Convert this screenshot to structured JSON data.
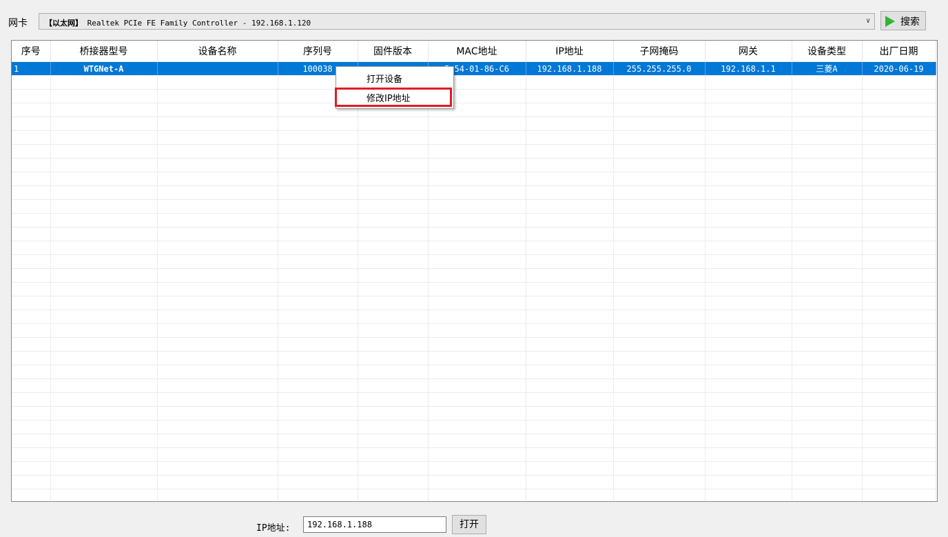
{
  "toolbar": {
    "nic_label": "网卡",
    "nic_prefix": "【以太网】",
    "nic_value": " Realtek PCIe FE Family Controller - 192.168.1.120",
    "search_label": "搜索"
  },
  "table": {
    "columns": [
      "序号",
      "桥接器型号",
      "设备名称",
      "序列号",
      "固件版本",
      "MAC地址",
      "IP地址",
      "子网掩码",
      "网关",
      "设备类型",
      "出厂日期"
    ],
    "selected_row": {
      "index": "1",
      "model": "WTGNet-A",
      "device_name": "",
      "serial": "100038",
      "firmware": "",
      "mac": "5-54-01-86-C6",
      "ip": "192.168.1.188",
      "mask": "255.255.255.0",
      "gateway": "192.168.1.1",
      "type": "三菱A",
      "date": "2020-06-19"
    }
  },
  "context_menu": {
    "open_device": "打开设备",
    "modify_ip": "修改IP地址"
  },
  "bottom": {
    "ip_label": "IP地址:",
    "ip_value": "192.168.1.188",
    "open_label": "打开"
  },
  "colors": {
    "selection": "#0078d7",
    "highlight": "#e01b24",
    "play_icon": "#2fb52f"
  }
}
